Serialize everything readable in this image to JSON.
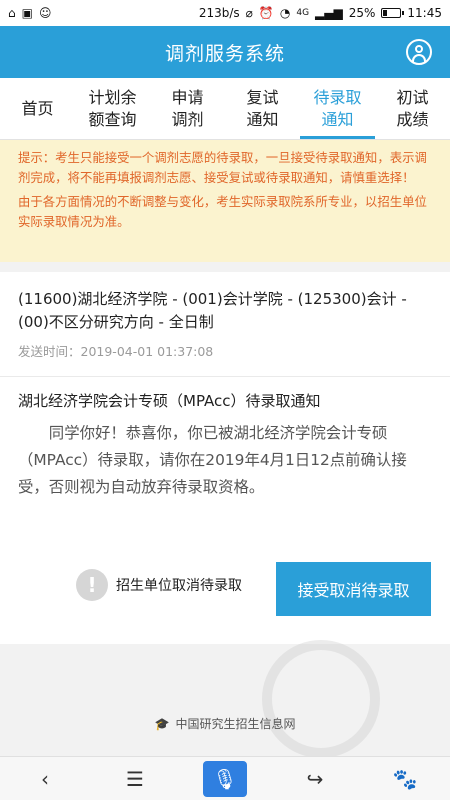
{
  "statusbar": {
    "speed": "213b/s",
    "battery": "25%",
    "battery_level": 0.25,
    "network": "4G",
    "time": "11:45"
  },
  "header": {
    "title": "调剂服务系统",
    "user_icon": "user-circle-icon"
  },
  "tabs": [
    {
      "label": "首页",
      "active": false
    },
    {
      "label": "计划余\n额查询",
      "active": false
    },
    {
      "label": "申请\n调剂",
      "active": false
    },
    {
      "label": "复试\n通知",
      "active": false
    },
    {
      "label": "待录取\n通知",
      "active": true
    },
    {
      "label": "初试\n成绩",
      "active": false
    }
  ],
  "notice": {
    "line1": "提示：考生只能接受一个调剂志愿的待录取，一旦接受待录取通知，表示调剂完成，将不能再填报调剂志愿、接受复试或待录取通知，请慎重选择！",
    "line2": "由于各方面情况的不断调整与变化，考生实际录取院系所专业，以招生单位实际录取情况为准。"
  },
  "message": {
    "program": "(11600)湖北经济学院 - (001)会计学院 - (125300)会计 - (00)不区分研究方向 - 全日制",
    "sent_time": "发送时间：2019-04-01 01:37:08",
    "title": "湖北经济学院会计专硕（MPAcc）待录取通知",
    "body": "同学你好！恭喜你，你已被湖北经济学院会计专硕（MPAcc）待录取，请你在2019年4月1日12点前确认接受，否则视为自动放弃待录取资格。"
  },
  "actions": {
    "reject_label": "招生单位取消待录取",
    "accept_label": "接受取消待录取"
  },
  "footer": {
    "text": "中国研究生招生信息网"
  },
  "colors": {
    "primary": "#2a9fd8",
    "notice_bg": "#fbf3cf",
    "notice_text": "#e0662a"
  }
}
